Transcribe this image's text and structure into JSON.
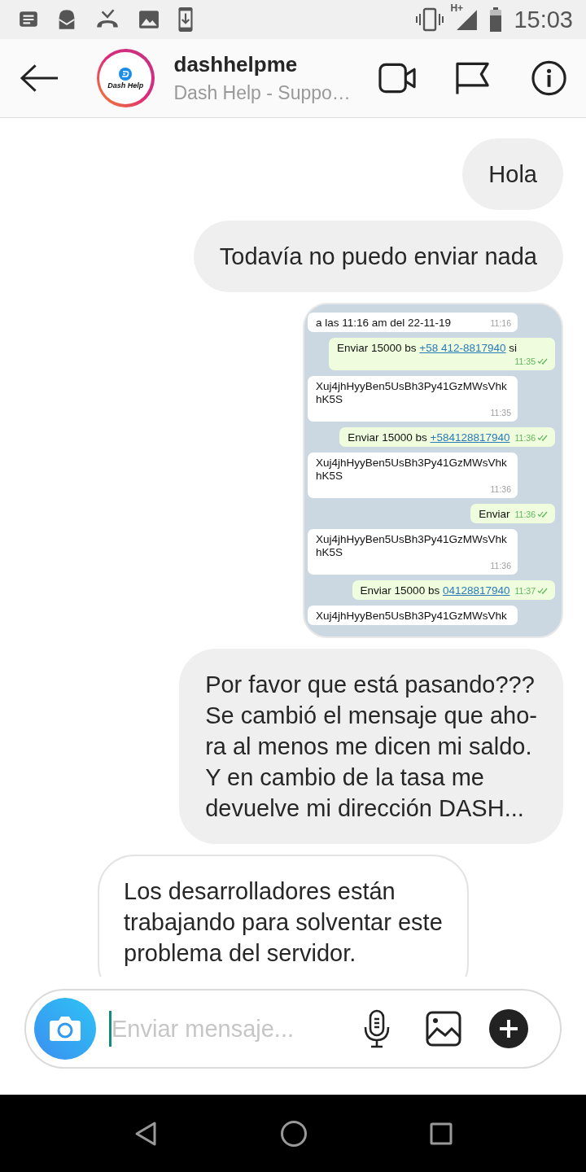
{
  "status_bar": {
    "network": "H+",
    "time": "15:03"
  },
  "header": {
    "avatar_text": "Dash Help",
    "title": "dashhelpme",
    "subtitle": "Dash Help - Suppo…"
  },
  "messages": [
    {
      "kind": "text",
      "outgoing": true,
      "text": "Hola"
    },
    {
      "kind": "text",
      "outgoing": true,
      "text": "Todavía no puedo enviar nada"
    },
    {
      "kind": "screenshot",
      "outgoing": true,
      "items": [
        {
          "outgoing": false,
          "text": "a las 11:16 am del 22-11-19",
          "time": "11:16"
        },
        {
          "outgoing": true,
          "text": "Enviar 15000 bs ",
          "link": "+58 412-8817940",
          "after": " si",
          "time": "11:35",
          "read": true
        },
        {
          "outgoing": false,
          "text": "Xuj4jhHyyBen5UsBh3Py41GzMWsVhkhK5S",
          "time": "11:35"
        },
        {
          "outgoing": true,
          "text": "Enviar 15000 bs ",
          "link": "+584128817940",
          "time": "11:36",
          "read": true
        },
        {
          "outgoing": false,
          "text": "Xuj4jhHyyBen5UsBh3Py41GzMWsVhkhK5S",
          "time": "11:36"
        },
        {
          "outgoing": true,
          "text": "Enviar",
          "time": "11:36",
          "read": true
        },
        {
          "outgoing": false,
          "text": "Xuj4jhHyyBen5UsBh3Py41GzMWsVhkhK5S",
          "time": "11:36"
        },
        {
          "outgoing": true,
          "text": "Enviar 15000 bs ",
          "link": "04128817940",
          "time": "11:37",
          "read": true
        },
        {
          "outgoing": false,
          "text": "Xuj4jhHyyBen5UsBh3Py41GzMWsVhk"
        }
      ]
    },
    {
      "kind": "text",
      "outgoing": true,
      "text": "Por favor que está pasando???\nSe cambió el mensaje que aho-\nra al menos me dicen mi saldo.\nY en cambio de la tasa me\ndevuelve mi dirección DASH..."
    },
    {
      "kind": "text",
      "outgoing": false,
      "text": "Los desarrolladores están\ntrabajando para solventar este\nproblema del servidor."
    }
  ],
  "composer": {
    "placeholder": "Enviar mensaje..."
  }
}
